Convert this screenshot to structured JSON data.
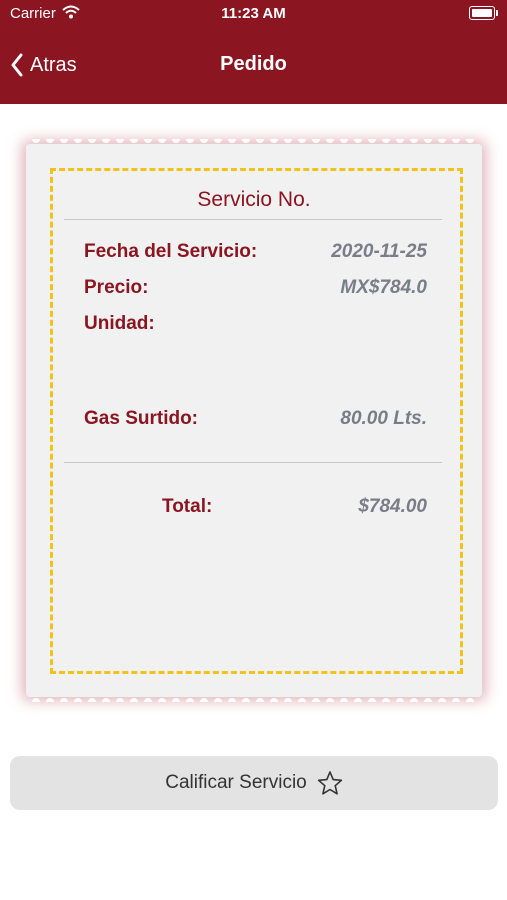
{
  "status_bar": {
    "carrier": "Carrier",
    "time": "11:23 AM"
  },
  "nav": {
    "back_label": "Atras",
    "title": "Pedido"
  },
  "receipt": {
    "title": "Servicio No.",
    "rows": [
      {
        "label": "Fecha del Servicio:",
        "value": "2020-11-25"
      },
      {
        "label": "Precio:",
        "value": "MX$784.0"
      },
      {
        "label": "Unidad:",
        "value": ""
      },
      {
        "label": "Gas Surtido:",
        "value": "80.00 Lts."
      }
    ],
    "total_label": "Total:",
    "total_value": "$784.00"
  },
  "actions": {
    "rate_label": "Calificar Servicio"
  },
  "colors": {
    "brand": "#8b1520",
    "dash": "#f2c21a",
    "value_text": "#7a7d88"
  }
}
